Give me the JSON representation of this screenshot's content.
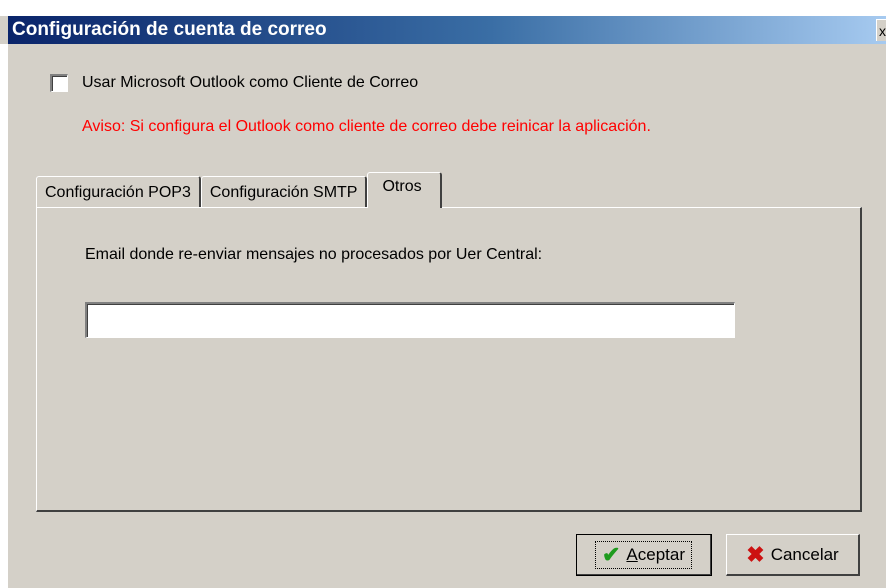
{
  "window": {
    "title": "Configuración de cuenta de correo",
    "close_label": "x"
  },
  "outlook_option": {
    "label": "Usar Microsoft Outlook como Cliente de Correo",
    "checked": false
  },
  "warning_text": "Aviso: Si configura el Outlook como cliente de correo debe reinicar la aplicación.",
  "tabs": [
    {
      "label": "Configuración POP3",
      "active": false
    },
    {
      "label": "Configuración SMTP",
      "active": false
    },
    {
      "label": "Otros",
      "active": true
    }
  ],
  "otros_panel": {
    "email_label": "Email donde re-enviar mensajes no procesados por Uer Central:",
    "email_value": ""
  },
  "buttons": {
    "ok_label": "Aceptar",
    "cancel_label": "Cancelar"
  },
  "icons": {
    "ok": "checkmark-icon",
    "cancel": "x-icon",
    "close": "close-icon"
  },
  "colors": {
    "warning": "#ff0000",
    "titlebar_start": "#0a246a",
    "titlebar_end": "#a6caf0",
    "dialog_bg": "#d4d0c8"
  }
}
